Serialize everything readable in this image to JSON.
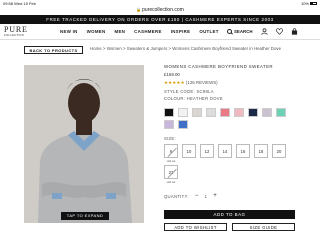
{
  "status_bar": {
    "time": "09:58",
    "date": "Wed 15 Feb",
    "battery": "10%"
  },
  "browser": {
    "url": "purecollection.com"
  },
  "promo": {
    "text": "FREE TRACKED DELIVERY ON ORDERS OVER £150 | CASHMERE EXPERTS SINCE 2003"
  },
  "header": {
    "logo_main": "PURE",
    "logo_sub": "COLLECTION",
    "nav": [
      "NEW IN",
      "WOMEN",
      "MEN",
      "CASHMERE",
      "INSPIRE",
      "OUTLET"
    ],
    "search_label": "SEARCH"
  },
  "back_button": "BACK TO PRODUCTS",
  "breadcrumb": "Home > Women > Sweaters & Jumpers > Womens Cashmere Boyfriend Sweater in Heather Dove",
  "image": {
    "zoom_label": "TAP TO EXPAND"
  },
  "product": {
    "title": "WOMENS CASHMERE BOYFRIEND SWEATER",
    "price": "£159.00",
    "stars": "★★★★★",
    "reviews": "(126 REVIEWS)",
    "style_code": "STYLE CODE: SC98LA",
    "colour": "COLOUR: HEATHER DOVE",
    "size_label": "SIZE:",
    "sizes": [
      "6",
      "10",
      "12",
      "14",
      "16",
      "18",
      "20",
      "22"
    ],
    "sold_out_label": "sold out",
    "quantity_label": "QUANTITY:",
    "quantity_minus": "−",
    "quantity_value": "1",
    "quantity_plus": "+"
  },
  "swatch_colors": [
    "#111111",
    "#f2f2f2",
    "#dad6cf",
    "#dcdcdc",
    "#e77a84",
    "#f0b8c1",
    "#1c2a4a",
    "#c9c2d3",
    "#6ed0b5",
    "#c7b7d9",
    "#3f6fc8"
  ],
  "actions": {
    "add_to_bag": "ADD TO BAG",
    "add_to_wishlist": "ADD TO WISHLIST",
    "size_guide": "SIZE GUIDE"
  }
}
